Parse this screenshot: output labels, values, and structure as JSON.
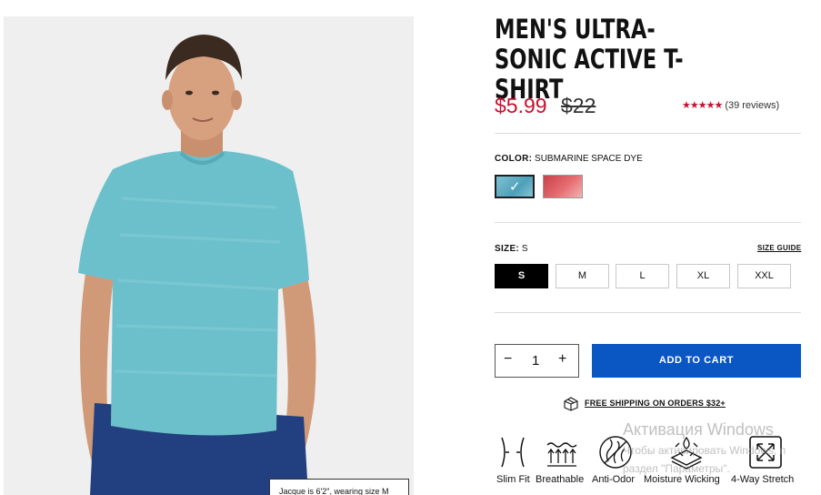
{
  "product": {
    "title": "MEN'S ULTRA-SONIC ACTIVE T-SHIRT",
    "price_sale": "$5.99",
    "price_original": "$22",
    "rating_stars": "★★★★★",
    "review_count": "(39 reviews)",
    "model_caption": "Jacque is 6'2\", wearing size M"
  },
  "color": {
    "label": "COLOR:",
    "selected_value": "SUBMARINE SPACE DYE",
    "swatches": [
      {
        "name": "Submarine Space Dye",
        "color": "#5fa9c2",
        "selected": true
      },
      {
        "name": "Red Space Dye",
        "color": "#d9575d",
        "selected": false
      }
    ]
  },
  "size": {
    "label": "SIZE:",
    "selected_value": "S",
    "guide_link": "SIZE GUIDE",
    "options": [
      "S",
      "M",
      "L",
      "XL",
      "XXL"
    ]
  },
  "cart": {
    "quantity": "1",
    "minus": "−",
    "plus": "+",
    "add_label": "ADD TO CART",
    "button_color": "#0a56c2"
  },
  "shipping": {
    "text": "FREE SHIPPING ON ORDERS $32+"
  },
  "features": [
    {
      "label": "Slim Fit",
      "icon": "slim-fit-icon"
    },
    {
      "label": "Breathable",
      "icon": "breathable-icon"
    },
    {
      "label": "Anti-Odor",
      "icon": "anti-odor-icon"
    },
    {
      "label": "Moisture Wicking",
      "icon": "moisture-wicking-icon"
    },
    {
      "label": "4-Way Stretch",
      "icon": "stretch-icon"
    }
  ],
  "watermark": {
    "line1": "Активация Windows",
    "line2": "Чтобы активировать Windows, п",
    "line3": "раздел \"Параметры\"."
  },
  "colors": {
    "accent_red": "#c8102e",
    "shirt": "#6cc0cc",
    "shorts": "#223f7f"
  }
}
